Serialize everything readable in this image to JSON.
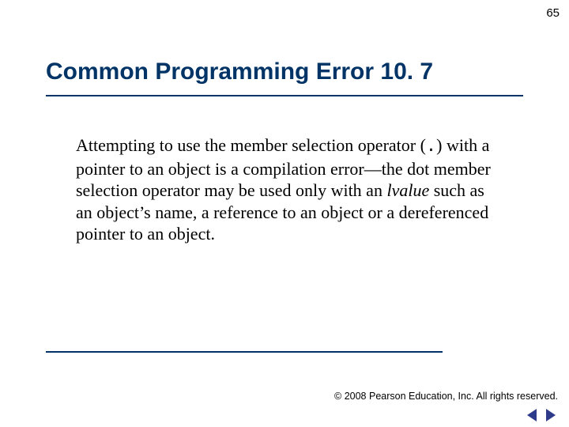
{
  "page_number": "65",
  "heading": "Common Programming Error 10. 7",
  "body": {
    "p1": "Attempting to use the member selection operator (",
    "op": ".",
    "p2": ") with a pointer to an object is a compilation error—the dot member selection operator may be used only with an ",
    "lvalue": "lvalue",
    "p3": " such as an object’s name, a reference to an object or a dereferenced pointer to an object."
  },
  "copyright": "© 2008 Pearson Education, Inc.  All rights reserved.",
  "nav": {
    "prev": "Previous",
    "next": "Next"
  }
}
